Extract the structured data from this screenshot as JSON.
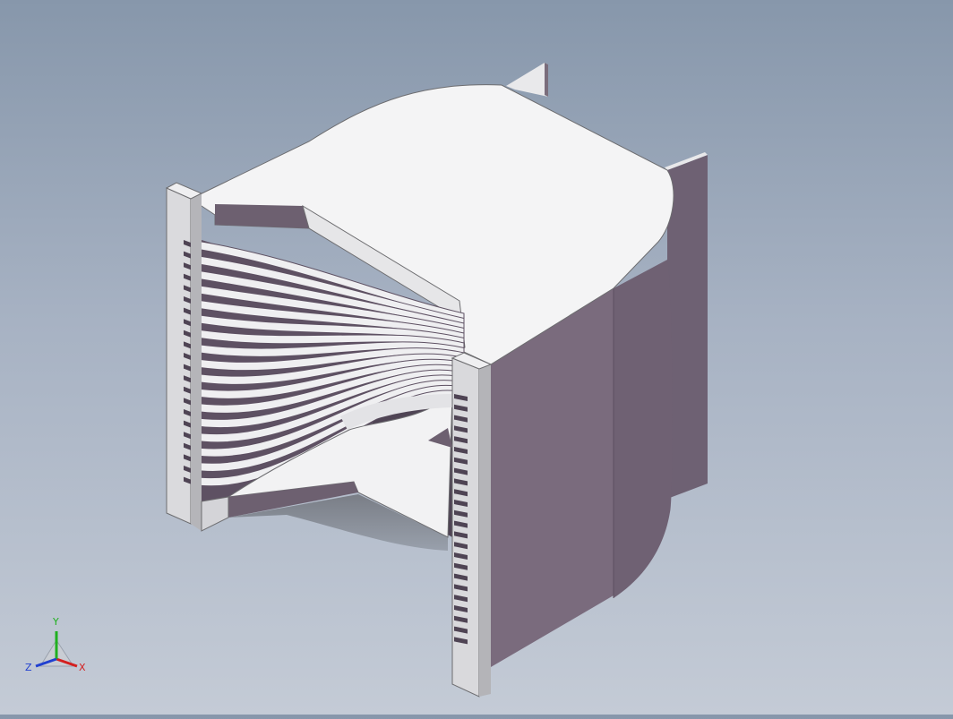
{
  "viewport": {
    "background_top": "#8797ab",
    "background_bottom": "#c4cbd6"
  },
  "model": {
    "top_face_color": "#f3f3f3",
    "side_face_color": "#786a7a",
    "dark_side_color": "#6c5f70",
    "plate_face_color": "#d9d9dc",
    "fin_count": 17
  },
  "triad": {
    "x_label": "X",
    "y_label": "Y",
    "z_label": "Z",
    "x_color": "#d42020",
    "y_color": "#20b020",
    "z_color": "#2040d0"
  }
}
